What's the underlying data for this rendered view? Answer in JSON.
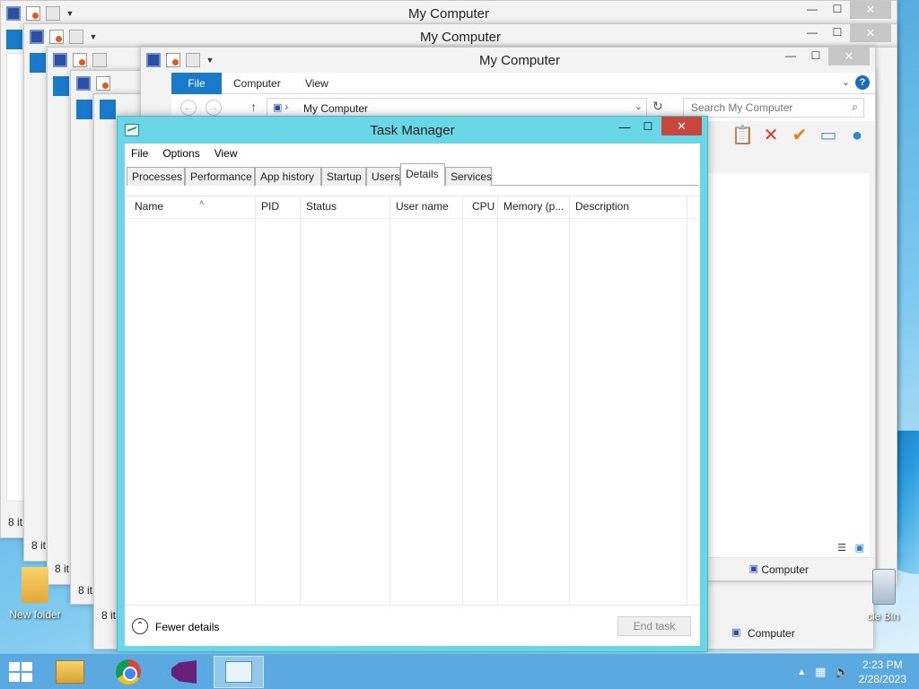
{
  "explorer": {
    "title": "My Computer",
    "status_count": "8 it",
    "front": {
      "tabs": [
        "File",
        "Computer",
        "View"
      ],
      "address": "My Computer",
      "search_placeholder": "Search My Computer",
      "status_item": "Computer",
      "status_item_back": "Computer",
      "status_item_partial": "puter"
    }
  },
  "taskmgr": {
    "title": "Task Manager",
    "menu": [
      "File",
      "Options",
      "View"
    ],
    "tabs": [
      "Processes",
      "Performance",
      "App history",
      "Startup",
      "Users",
      "Details",
      "Services"
    ],
    "active_tab": "Details",
    "columns": [
      "Name",
      "PID",
      "Status",
      "User name",
      "CPU",
      "Memory (p...",
      "Description"
    ],
    "fewer_details": "Fewer details",
    "end_task": "End task"
  },
  "desktop": {
    "new_folder": "New folder",
    "recycle_bin": "cle Bin"
  },
  "taskbar": {
    "time": "2:23 PM",
    "date": "2/28/2023"
  },
  "colors": {
    "taskmgr_frame": "#69d7e6",
    "close_red": "#c7473f",
    "file_tab_blue": "#1979ca",
    "taskbar": "#5aa9e0"
  }
}
